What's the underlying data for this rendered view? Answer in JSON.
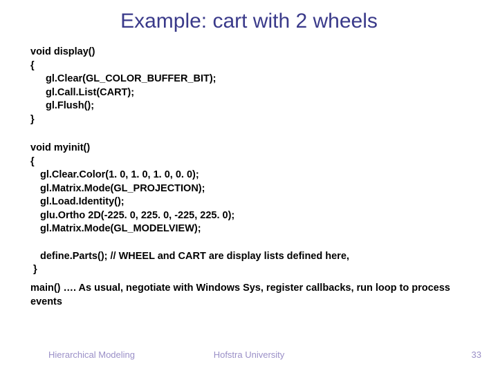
{
  "title": "Example: cart with 2 wheels",
  "code": {
    "display": {
      "sig": "void display()",
      "open": "{",
      "l1": "gl.Clear(GL_COLOR_BUFFER_BIT);",
      "l2": "gl.Call.List(CART);",
      "l3": "gl.Flush();",
      "close": "}"
    },
    "myinit": {
      "sig": "void myinit()",
      "open": "{",
      "l1": "gl.Clear.Color(1. 0, 1. 0, 1. 0, 0. 0);",
      "l2": "gl.Matrix.Mode(GL_PROJECTION);",
      "l3": "gl.Load.Identity();",
      "l4": "glu.Ortho 2D(-225. 0, 225. 0, -225, 225. 0);",
      "l5": "gl.Matrix.Mode(GL_MODELVIEW);",
      "blank": "",
      "l6": "define.Parts(); // WHEEL and CART are display lists defined here,",
      "close": "}"
    },
    "main": "main() …. As usual, negotiate with Windows Sys, register callbacks, run loop to process events"
  },
  "footer": {
    "left": "Hierarchical Modeling",
    "center": "Hofstra University",
    "right": "33"
  }
}
